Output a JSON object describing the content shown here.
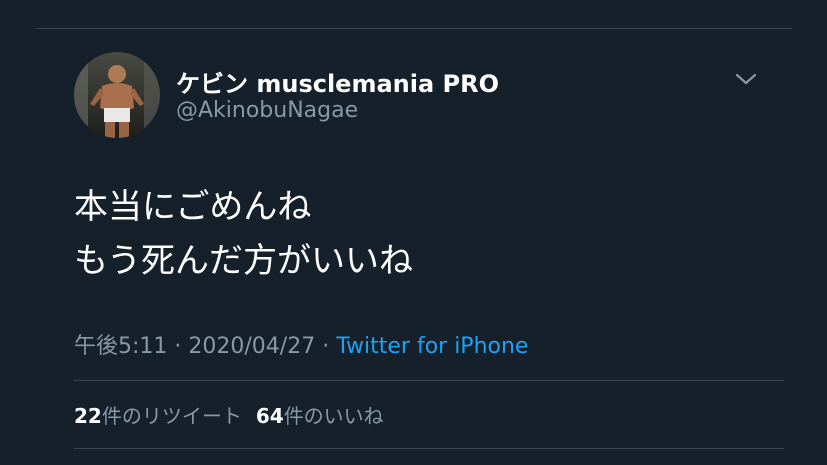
{
  "tweet": {
    "display_name": "ケビン musclemania PRO",
    "handle": "@AkinobuNagae",
    "text_lines": [
      "本当にごめんね",
      "もう死んだ方がいいね"
    ],
    "time": "午後5:11",
    "separator": "·",
    "date": "2020/04/27",
    "source": "Twitter for iPhone",
    "retweet_count": "22",
    "retweet_label": "件のリツイート",
    "like_count": "64",
    "like_label": "件のいいね"
  },
  "icons": {
    "menu": "chevron-down-icon",
    "avatar": "profile-photo"
  },
  "colors": {
    "background": "#15202b",
    "text_primary": "#ffffff",
    "text_secondary": "#8899a6",
    "link": "#1da1f2",
    "divider": "#38444d"
  }
}
